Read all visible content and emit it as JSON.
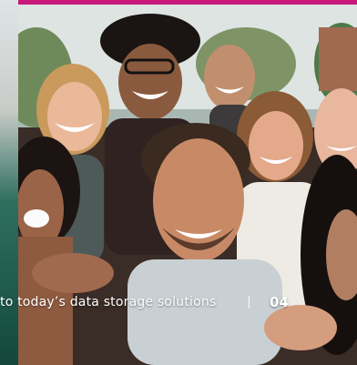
{
  "footer": {
    "text": "to today’s data storage solutions",
    "page_number": "04"
  },
  "colors": {
    "accent_bar": "#c8197a",
    "footer_text": "#ffffff"
  },
  "photo": {
    "subject": "group-selfie-photo"
  }
}
